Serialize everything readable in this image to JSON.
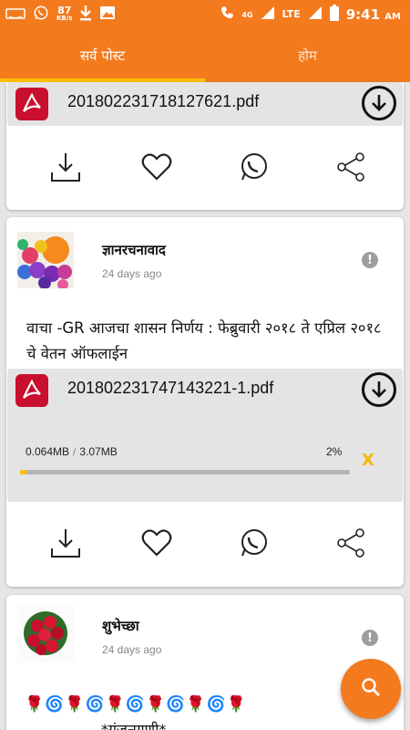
{
  "status_bar": {
    "carrier_icon": "amazon-icon",
    "net_speed_value": "87",
    "net_speed_unit": "KB/s",
    "network_type": "4G",
    "signal_label": "LTE",
    "time": "9:41",
    "ampm": "AM"
  },
  "tabs": [
    {
      "label": "सर्व पोस्ट",
      "selected": true
    },
    {
      "label": "होम",
      "selected": false
    }
  ],
  "colors": {
    "accent": "#f47a1e",
    "indicator": "#ffc107",
    "pdf_red": "#c8102e"
  },
  "posts": [
    {
      "pdf": {
        "file_name": "201802231718127621.pdf"
      },
      "actions": [
        "download-icon",
        "heart-icon",
        "whatsapp-icon",
        "share-icon"
      ]
    },
    {
      "author": "ज्ञानरचनावाद",
      "age": "24 days ago",
      "text": "वाचा -GR आजचा शासन निर्णय : फेब्रुवारी २०१८ ते एप्रिल २०१८ चे वेतन ऑफलाईन",
      "pdf": {
        "file_name": "201802231747143221-1.pdf",
        "downloaded": "0.064MB",
        "separator": "/",
        "total": "3.07MB",
        "percent_label": "2%",
        "progress": 0.02,
        "cancel_label": "X"
      },
      "actions": [
        "download-icon",
        "heart-icon",
        "whatsapp-icon",
        "share-icon"
      ]
    },
    {
      "author": "शुभेच्छा",
      "age": "24 days ago",
      "emoji_row": "🌹🌀🌹🌀🌹🌀🌹🌀🌹🌀🌹",
      "caption": "*गुंजन्माणी*"
    }
  ],
  "fab_icon": "search-icon"
}
